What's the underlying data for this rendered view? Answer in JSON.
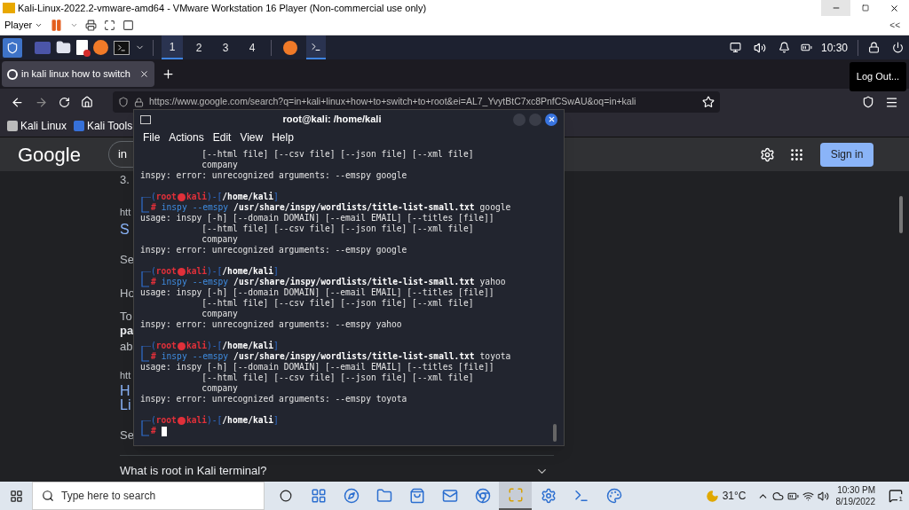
{
  "vm_window": {
    "title": "Kali-Linux-2022.2-vmware-amd64 - VMware Workstation 16 Player (Non-commercial use only)",
    "player_menu": "Player",
    "collapse": "<<"
  },
  "kali_panel": {
    "workspaces": [
      {
        "label": "1",
        "selected": true
      },
      {
        "label": "2",
        "selected": false
      },
      {
        "label": "3",
        "selected": false
      },
      {
        "label": "4",
        "selected": false
      }
    ],
    "clock": "10:30"
  },
  "logout_tooltip": "Log Out...",
  "browser": {
    "tab": {
      "title": "in kali linux how to switch"
    },
    "url": "https://www.google.com/search?q=in+kali+linux+how+to+switch+to+root&ei=AL7_YvytBtC7xc8PnfCSwAU&oq=in+kali",
    "bookmarks": [
      "Kali Linux",
      "Kali Tools"
    ],
    "google": {
      "logo": "Google",
      "search_value": "in",
      "sign_in": "Sign in"
    },
    "fragments": [
      {
        "kind": "plain",
        "text": "3."
      },
      {
        "kind": "url",
        "text": "htt"
      },
      {
        "kind": "title",
        "text": "S"
      },
      {
        "kind": "plain",
        "text": "Se"
      },
      {
        "kind": "plain",
        "text": "Ho"
      },
      {
        "kind": "plain",
        "text": "To"
      },
      {
        "kind": "bold",
        "text": "pa"
      },
      {
        "kind": "plain",
        "text": "ab"
      },
      {
        "kind": "url",
        "text": "htt"
      },
      {
        "kind": "title",
        "text": "H"
      },
      {
        "kind": "title",
        "text": "Li"
      },
      {
        "kind": "plain",
        "text": "Se"
      }
    ],
    "question": "What is root in Kali terminal?"
  },
  "terminal": {
    "title": "root@kali: /home/kali",
    "menu": [
      "File",
      "Actions",
      "Edit",
      "View",
      "Help"
    ],
    "lines": [
      {
        "kind": "output",
        "text": "            [--html file] [--csv file] [--json file] [--xml file]"
      },
      {
        "kind": "output",
        "text": "            company"
      },
      {
        "kind": "output",
        "text": "inspy: error: unrecognized arguments: --emspy google"
      },
      {
        "kind": "prompt",
        "open": "(",
        "user": "root",
        "host": "kali",
        "sep": ")-[",
        "path": "/home/kali",
        "close": "]",
        "mark": "#",
        "command": "inspy",
        "option": "--emspy",
        "file": "/usr/share/inspy/wordlists/title-list-small.txt",
        "arg": "google",
        "cursor": false
      },
      {
        "kind": "output",
        "text": "usage: inspy [-h] [--domain DOMAIN] [--email EMAIL] [--titles [file]]"
      },
      {
        "kind": "output",
        "text": "            [--html file] [--csv file] [--json file] [--xml file]"
      },
      {
        "kind": "output",
        "text": "            company"
      },
      {
        "kind": "output",
        "text": "inspy: error: unrecognized arguments: --emspy google"
      },
      {
        "kind": "prompt",
        "open": "(",
        "user": "root",
        "host": "kali",
        "sep": ")-[",
        "path": "/home/kali",
        "close": "]",
        "mark": "#",
        "command": "inspy",
        "option": "--emspy",
        "file": "/usr/share/inspy/wordlists/title-list-small.txt",
        "arg": "yahoo",
        "cursor": false
      },
      {
        "kind": "output",
        "text": "usage: inspy [-h] [--domain DOMAIN] [--email EMAIL] [--titles [file]]"
      },
      {
        "kind": "output",
        "text": "            [--html file] [--csv file] [--json file] [--xml file]"
      },
      {
        "kind": "output",
        "text": "            company"
      },
      {
        "kind": "output",
        "text": "inspy: error: unrecognized arguments: --emspy yahoo"
      },
      {
        "kind": "prompt",
        "open": "(",
        "user": "root",
        "host": "kali",
        "sep": ")-[",
        "path": "/home/kali",
        "close": "]",
        "mark": "#",
        "command": "inspy",
        "option": "--emspy",
        "file": "/usr/share/inspy/wordlists/title-list-small.txt",
        "arg": "toyota",
        "cursor": false
      },
      {
        "kind": "output",
        "text": "usage: inspy [-h] [--domain DOMAIN] [--email EMAIL] [--titles [file]]"
      },
      {
        "kind": "output",
        "text": "            [--html file] [--csv file] [--json file] [--xml file]"
      },
      {
        "kind": "output",
        "text": "            company"
      },
      {
        "kind": "output",
        "text": "inspy: error: unrecognized arguments: --emspy toyota"
      },
      {
        "kind": "prompt",
        "open": "(",
        "user": "root",
        "host": "kali",
        "sep": ")-[",
        "path": "/home/kali",
        "close": "]",
        "mark": "#",
        "cursor": true
      }
    ]
  },
  "taskbar": {
    "search_placeholder": "Type here to search",
    "apps": [
      {
        "selected": false
      },
      {
        "selected": false
      },
      {
        "selected": false
      },
      {
        "selected": false
      },
      {
        "selected": false
      },
      {
        "selected": false
      },
      {
        "selected": true
      },
      {
        "selected": false
      },
      {
        "selected": false
      },
      {
        "selected": false
      }
    ],
    "temperature": "31°C",
    "time": "10:30 PM",
    "date": "8/19/2022",
    "notifications": "1"
  }
}
